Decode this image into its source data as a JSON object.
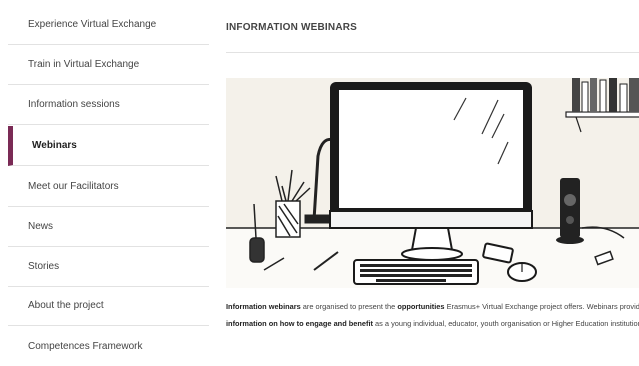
{
  "sidebar": {
    "items": [
      {
        "label": "Experience Virtual Exchange",
        "active": false
      },
      {
        "label": "Train in Virtual Exchange",
        "active": false
      },
      {
        "label": "Information sessions",
        "active": false
      },
      {
        "label": "Webinars",
        "active": true
      },
      {
        "label": "Meet our Facilitators",
        "active": false
      },
      {
        "label": "News",
        "active": false
      },
      {
        "label": "Stories",
        "active": false
      },
      {
        "label": "About the project",
        "active": false
      },
      {
        "label": "Competences Framework",
        "active": false
      }
    ]
  },
  "main": {
    "title": "INFORMATION WEBINARS",
    "body": {
      "s1_bold": "Information webinars",
      "s2": " are organised to present the ",
      "s3_bold": "opportunities",
      "s4": " Erasmus+ Virtual Exchange project offers. Webinars provide ",
      "s5_bold": "information on how to engage and benefit",
      "s6": " as a young individual, educator, youth organisation or Higher Education institution."
    }
  },
  "colors": {
    "accent": "#7a2a55",
    "divider": "#e2e2e2",
    "text": "#444444"
  }
}
